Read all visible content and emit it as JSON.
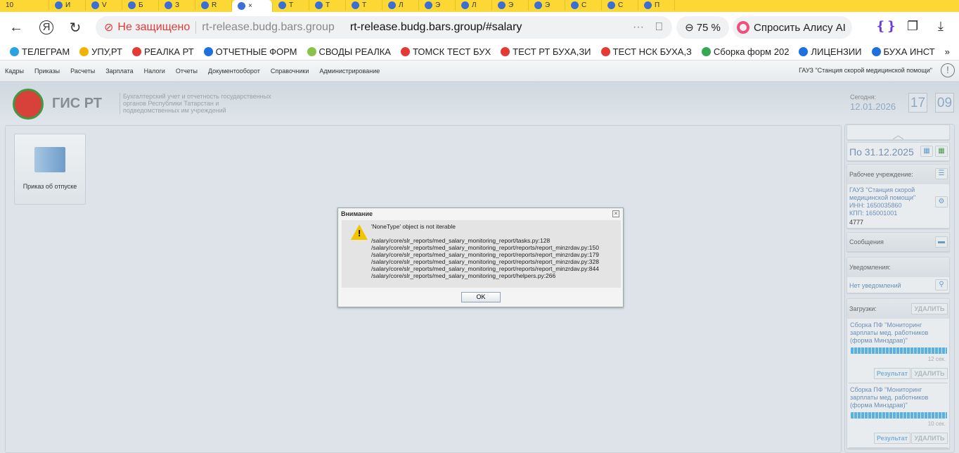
{
  "browser": {
    "tabs": [
      "10",
      "И",
      "V",
      "Б",
      "З",
      "R",
      "×",
      "Т",
      "Т",
      "Т",
      "Л",
      "Э",
      "Л",
      "Э",
      "Э",
      "С",
      "С",
      "П"
    ],
    "security_label": "Не защищено",
    "host": "rt-release.budg.bars.group",
    "url": "rt-release.budg.bars.group/#salary",
    "zoom": "75 %",
    "alice_label": "Спросить Алису AI",
    "bookmarks": [
      {
        "label": "ТЕЛЕГРАМ",
        "color": "#2aa3e0"
      },
      {
        "label": "УПУ,РТ",
        "color": "#f0b400"
      },
      {
        "label": "РЕАЛКА РТ",
        "color": "#e53935"
      },
      {
        "label": "ОТЧЕТНЫЕ ФОРМ",
        "color": "#1e6fe0"
      },
      {
        "label": "СВОДЫ РЕАЛКА",
        "color": "#8bc34a"
      },
      {
        "label": "ТОМСК ТЕСТ БУХ",
        "color": "#e53935"
      },
      {
        "label": "ТЕСТ РТ БУХА,ЗИ",
        "color": "#e53935"
      },
      {
        "label": "ТЕСТ НСК БУХА,З",
        "color": "#e53935"
      },
      {
        "label": "Сборка форм 202",
        "color": "#34a853"
      },
      {
        "label": "ЛИЦЕНЗИИ",
        "color": "#1e6fe0"
      },
      {
        "label": "БУХА ИНСТ",
        "color": "#1e6fe0"
      }
    ],
    "more": "»"
  },
  "menu": [
    "Кадры",
    "Приказы",
    "Расчеты",
    "Зарплата",
    "Налоги",
    "Отчеты",
    "Документооборот",
    "Справочники",
    "Администрирование"
  ],
  "org_top": "ГАУЗ \"Станция скорой медицинской помощи\"",
  "header": {
    "title": "ГИС РТ",
    "desc": "Бухгалтерский учет и отчетность государственных органов Республики Татарстан и подведомственных им учреждений",
    "today_label": "Сегодня:",
    "today": "12.01.2026",
    "hours": "17",
    "minutes": "09"
  },
  "tile": {
    "label": "Приказ об отпуске"
  },
  "side": {
    "period": "По 31.12.2025",
    "org_label": "Рабочее учреждение:",
    "org_name": "ГАУЗ \"Станция скорой медицинской помощи\"",
    "inn": "ИНН: 1650035860",
    "kpp": "КПП: 165001001",
    "code": "4777",
    "messages": "Сообщения",
    "notif_label": "Уведомления:",
    "notif_text": "Нет уведомлений",
    "downloads_label": "Загрузки:",
    "delete": "УДАЛИТЬ",
    "result": "Результат",
    "downloads": [
      {
        "name": "Сборка ПФ \"Мониторинг зарплаты мед. работников (форма Минздрав)\"",
        "time": "12 сек.",
        "progress": 100
      },
      {
        "name": "Сборка ПФ \"Мониторинг зарплаты мед. работников (форма Минздрав)\"",
        "time": "10 сек.",
        "progress": 100
      }
    ]
  },
  "dialog": {
    "title": "Внимание",
    "message": "'NoneType' object is not iterable",
    "trace": [
      "/salary/core/slr_reports/med_salary_monitoring_report/tasks.py:128",
      "/salary/core/slr_reports/med_salary_monitoring_report/reports/report_minzrdav.py:150",
      "/salary/core/slr_reports/med_salary_monitoring_report/reports/report_minzrdav.py:179",
      "/salary/core/slr_reports/med_salary_monitoring_report/reports/report_minzrdav.py:328",
      "/salary/core/slr_reports/med_salary_monitoring_report/reports/report_minzrdav.py:844",
      "/salary/core/slr_reports/med_salary_monitoring_report/helpers.py:266"
    ],
    "ok": "OK"
  }
}
